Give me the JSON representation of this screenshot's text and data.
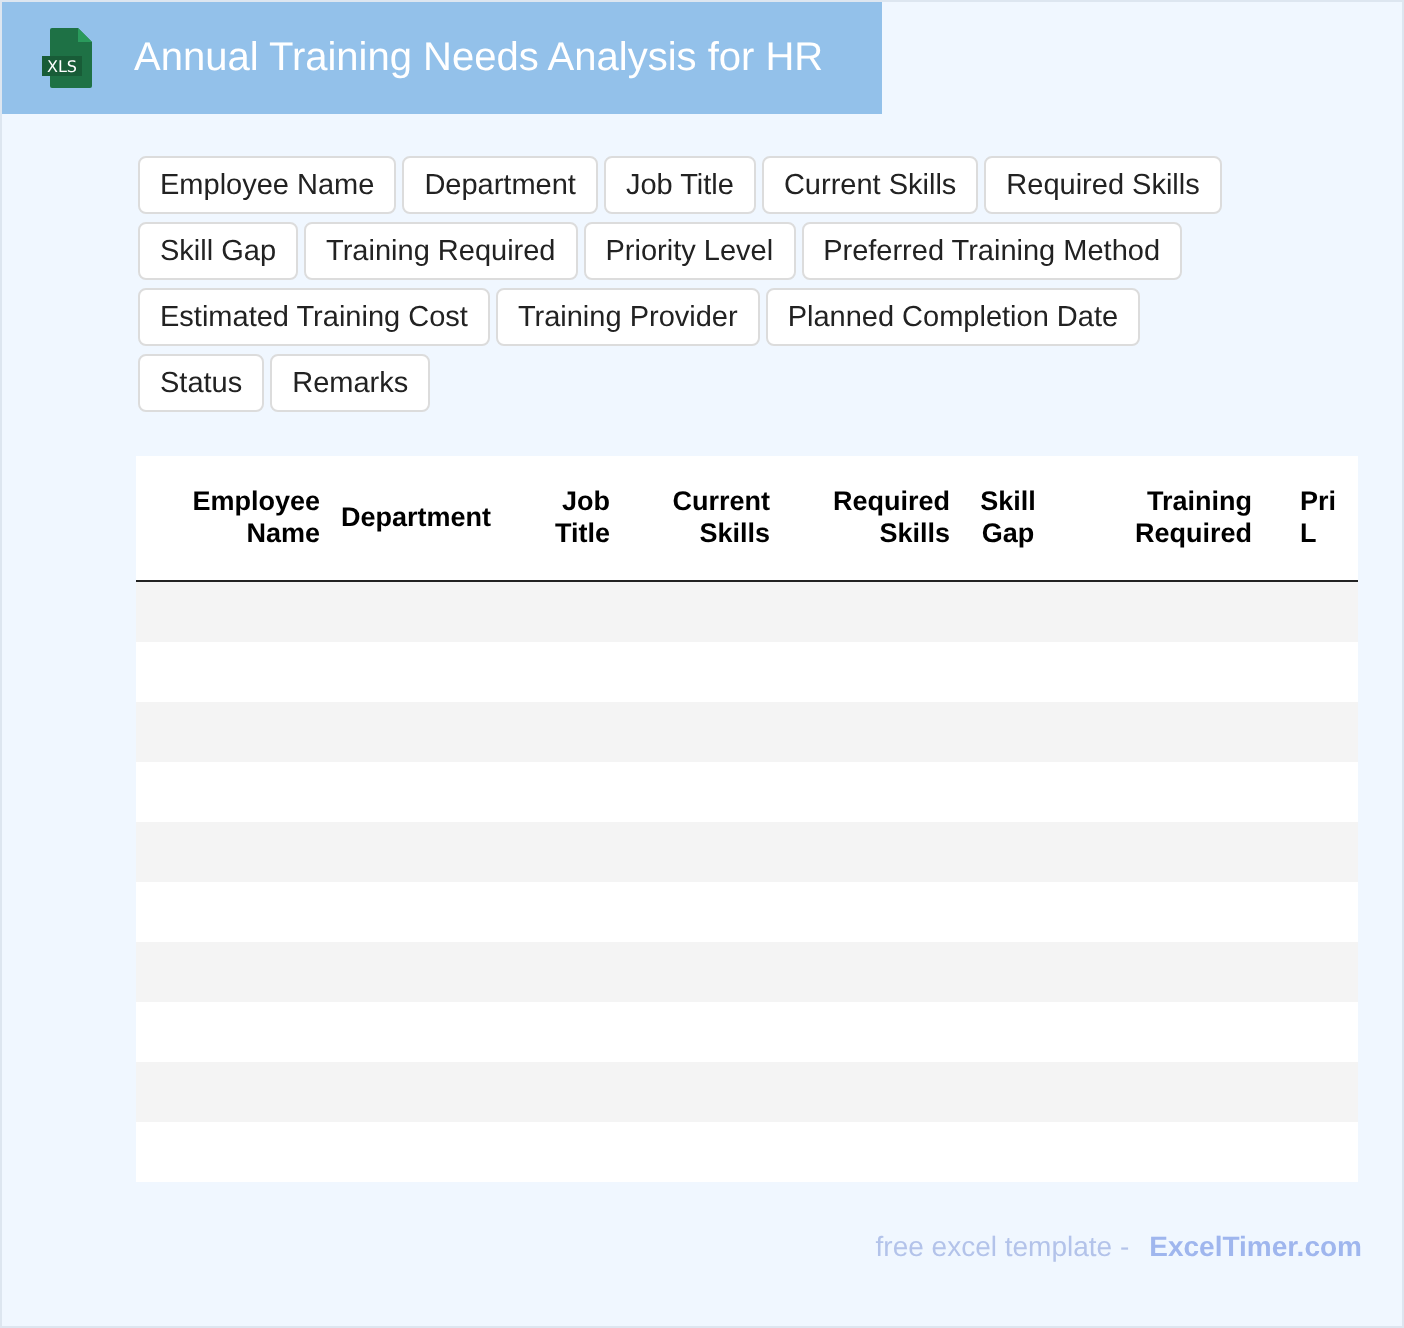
{
  "header": {
    "icon_label": "XLS",
    "title": "Annual Training Needs Analysis for HR"
  },
  "field_tags": [
    "Employee Name",
    "Department",
    "Job Title",
    "Current Skills",
    "Required Skills",
    "Skill Gap",
    "Training Required",
    "Priority Level",
    "Preferred Training Method",
    "Estimated Training Cost",
    "Training Provider",
    "Planned Completion Date",
    "Status",
    "Remarks"
  ],
  "table": {
    "columns": [
      {
        "lines": [
          "Employee",
          "Name"
        ]
      },
      {
        "lines": [
          "Department"
        ]
      },
      {
        "lines": [
          "Job",
          "Title"
        ]
      },
      {
        "lines": [
          "Current",
          "Skills"
        ]
      },
      {
        "lines": [
          "Required",
          "Skills"
        ]
      },
      {
        "lines": [
          "Skill",
          "Gap"
        ]
      },
      {
        "lines": [
          "Training",
          "Required"
        ]
      },
      {
        "lines": [
          "Pri",
          "L"
        ]
      }
    ]
  },
  "footer": {
    "text": "free excel template -",
    "link": "ExcelTimer.com"
  }
}
